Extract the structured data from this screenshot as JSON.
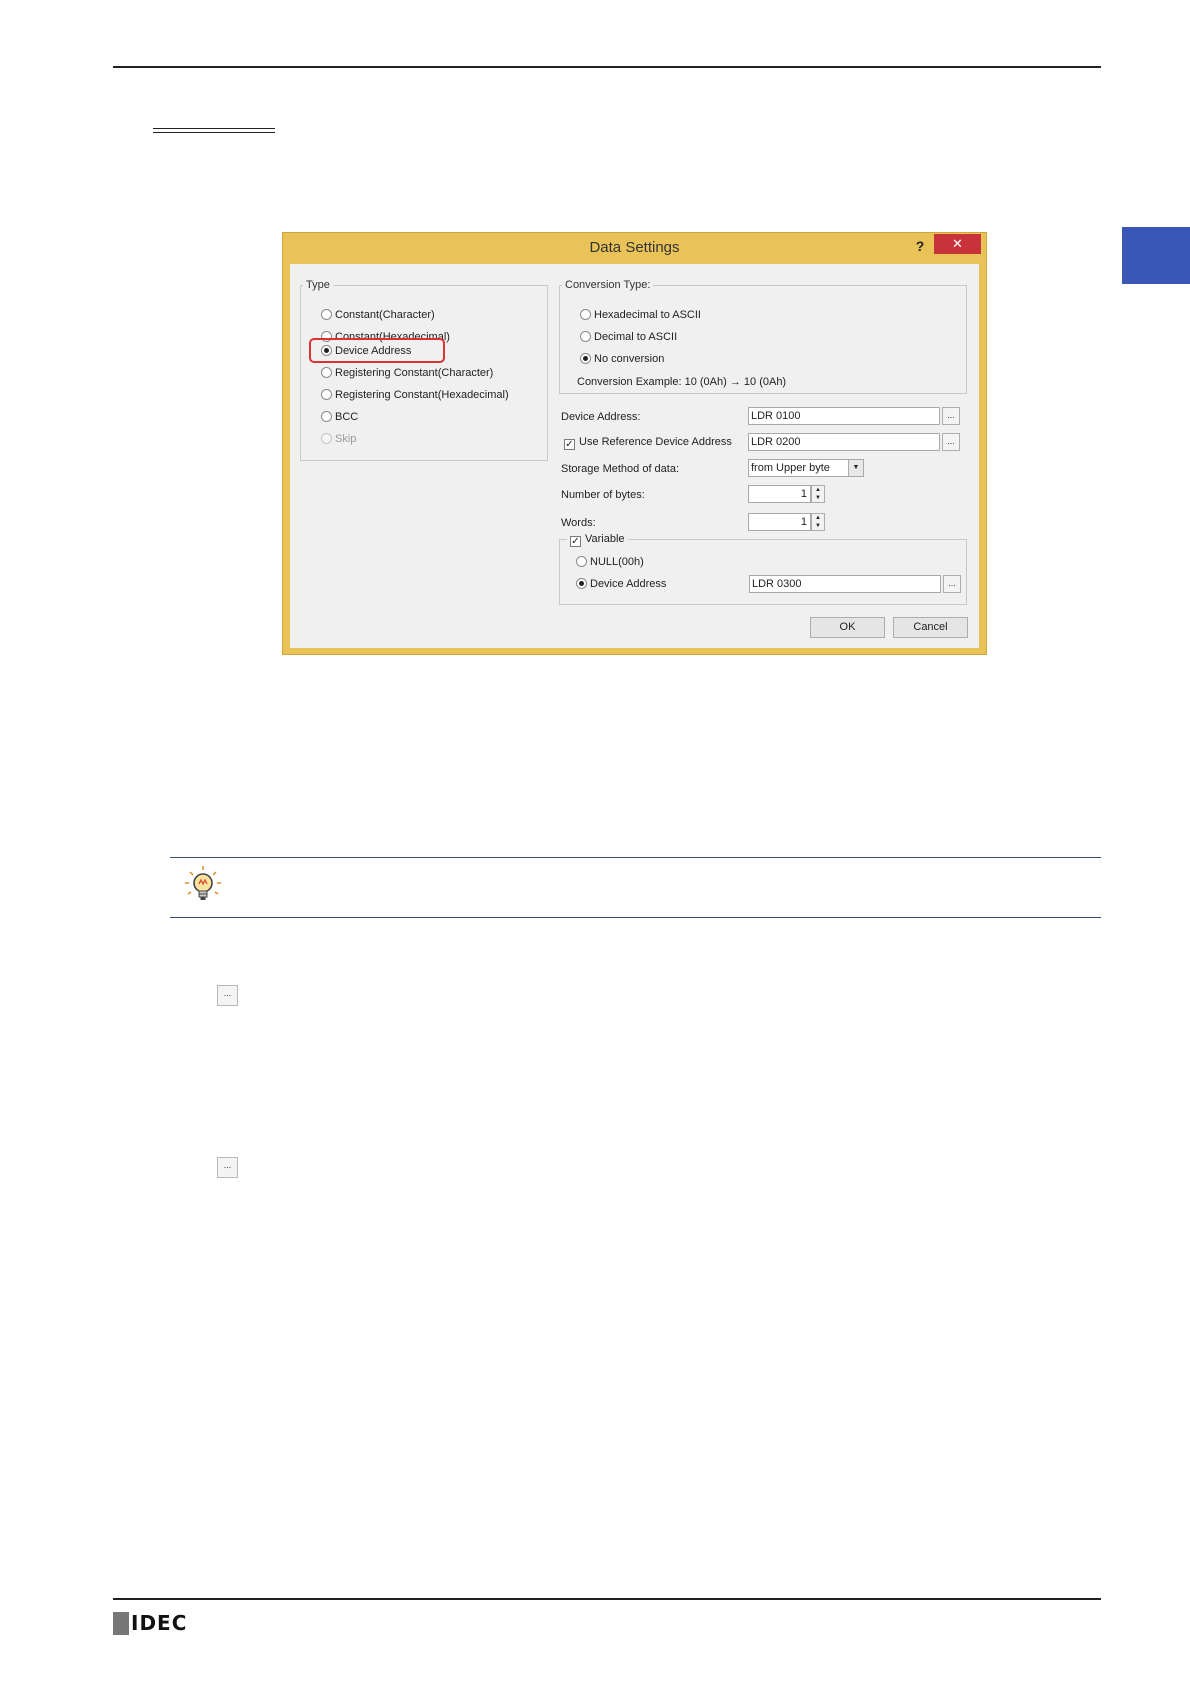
{
  "dialog": {
    "title": "Data Settings",
    "help_label": "?",
    "close_label": "✕",
    "type_group": {
      "legend": "Type",
      "options": [
        {
          "label": "Constant(Character)",
          "selected": false,
          "enabled": true
        },
        {
          "label": "Constant(Hexadecimal)",
          "selected": false,
          "enabled": true
        },
        {
          "label": "Device Address",
          "selected": true,
          "enabled": true
        },
        {
          "label": "Registering Constant(Character)",
          "selected": false,
          "enabled": true
        },
        {
          "label": "Registering Constant(Hexadecimal)",
          "selected": false,
          "enabled": true
        },
        {
          "label": "BCC",
          "selected": false,
          "enabled": true
        },
        {
          "label": "Skip",
          "selected": false,
          "enabled": false
        }
      ]
    },
    "conversion_group": {
      "legend": "Conversion Type:",
      "options": [
        {
          "label": "Hexadecimal to ASCII",
          "selected": false
        },
        {
          "label": "Decimal to ASCII",
          "selected": false
        },
        {
          "label": "No conversion",
          "selected": true
        }
      ],
      "example": "Conversion Example: 10 (0Ah) → 10 (0Ah)"
    },
    "device_address": {
      "label": "Device Address:",
      "value": "LDR 0100"
    },
    "use_reference": {
      "label": "Use Reference Device Address",
      "checked": true,
      "value": "LDR 0200"
    },
    "storage_method": {
      "label": "Storage Method of data:",
      "value": "from Upper byte"
    },
    "number_of_bytes": {
      "label": "Number of bytes:",
      "value": "1"
    },
    "words": {
      "label": "Words:",
      "value": "1"
    },
    "variable_group": {
      "legend": "Variable",
      "checked": true,
      "options": [
        {
          "label": "NULL(00h)",
          "selected": false
        },
        {
          "label": "Device Address",
          "selected": true
        }
      ],
      "value": "LDR 0300"
    },
    "ok_label": "OK",
    "cancel_label": "Cancel",
    "ellipsis_label": "..."
  },
  "page": {
    "ellipsis_label": "...",
    "logo_text": "IDEC"
  }
}
